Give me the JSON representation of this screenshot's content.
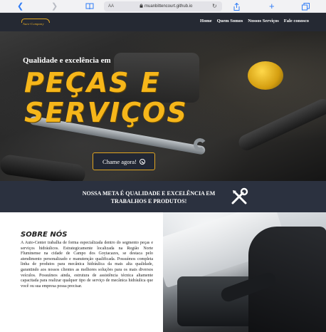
{
  "browser": {
    "address_prefix": "AA",
    "url": "muanbittencourt.github.io",
    "icons": [
      "back-icon",
      "forward-icon",
      "bookmarks-icon",
      "lock-icon",
      "reload-icon",
      "share-icon",
      "new-tab-icon",
      "tabs-icon"
    ]
  },
  "site": {
    "logo_text": "Auto-Company",
    "nav": [
      "Home",
      "Quem Somos",
      "Nossos Serviços",
      "Fale conosco"
    ]
  },
  "hero": {
    "tagline": "Qualidade e excelência em",
    "headline_line1": "PEÇAS E",
    "headline_line2": "SERVIÇOS",
    "cta_label": "Chame agora!",
    "cta_icon": "whatsapp-icon"
  },
  "mission": {
    "text": "NOSSA META É QUALIDADE E EXCELÊNCIA EM TRABALHOS E PRODUTOS!",
    "icon": "tools-icon"
  },
  "about": {
    "title": "SOBRE NÓS",
    "text": "A Auto-Center trabalha de forma especializada dentro do segmento peças e serviços hidráulicos. Estrategicamente localizada na Região Norte Fluminense na cidade de Campo dos Goytacazes, se destaca pelo atendimento personalizado e manutenção qualificada. Possuímos completa linha de produtos para mecânica hidráulica da mais alta qualidade, garantindo aos nossos clientes as melhores soluções para os mais diversos veículos. Possuímos ainda, estrutura de assistência técnica altamente capacitada para realizar qualquer tipo de serviço de mecânica hidráulica que você ou sua empresa possa precisar."
  },
  "colors": {
    "nav_bg": "#252933",
    "accent": "#f6b61a",
    "mission_bg": "#2b313f",
    "browser_blue": "#2f7cf6"
  }
}
